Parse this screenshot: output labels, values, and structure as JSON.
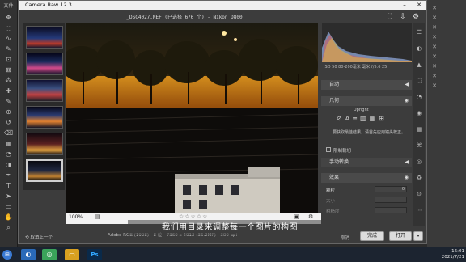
{
  "app": {
    "title": "Camera Raw 12.3",
    "filename": "_DSC4027.NEF (已选择 6/6 个) - Nikon D800"
  },
  "ps_left": {
    "tab_label": "文件"
  },
  "ps_left_tools": [
    "move-icon",
    "marquee-icon",
    "lasso-icon",
    "quick-select-icon",
    "crop-icon",
    "frame-icon",
    "eyedropper-icon",
    "heal-icon",
    "brush-icon",
    "stamp-icon",
    "history-brush-icon",
    "eraser-icon",
    "gradient-icon",
    "blur-icon",
    "dodge-icon",
    "pen-icon",
    "type-icon",
    "path-select-icon",
    "shape-icon",
    "hand-icon",
    "zoom-icon"
  ],
  "ps_right_tabs": [
    "X",
    "X",
    "X",
    "X",
    "X",
    "X",
    "X",
    "X",
    "X"
  ],
  "exif": "ISO 50  80-200毫米 毫米   f/5.6   25",
  "panel": {
    "edit_label": "自动",
    "geometry_label": "几何",
    "upright_label": "Upright",
    "upright_hint": "要获取最佳结果，请首先应用镜头校正。",
    "constrain_label": "限制裁切",
    "manual_label": "手动转换",
    "effects_label": "效果",
    "grain_label": "颗粒",
    "grain_value": "0",
    "size_label": "大小",
    "roughness_label": "粗糙度"
  },
  "bottom": {
    "zoom": "100%",
    "fileinfo": "Adobe RGB (1998) - 8 位 - 7360 x 4912 (36.2MP) - 300 ppi"
  },
  "buttons": {
    "back": "取消上一个",
    "done": "完成",
    "open": "打开",
    "cancel": "取消"
  },
  "subtitle": "我们用目录来调整每一个图片的构图",
  "taskbar": {
    "time": "16:01",
    "date": "2021/7/21",
    "ps_label": "Ps"
  },
  "colors": {
    "accent": "#3a7ad4",
    "panel_bg": "#3c3c3c"
  }
}
